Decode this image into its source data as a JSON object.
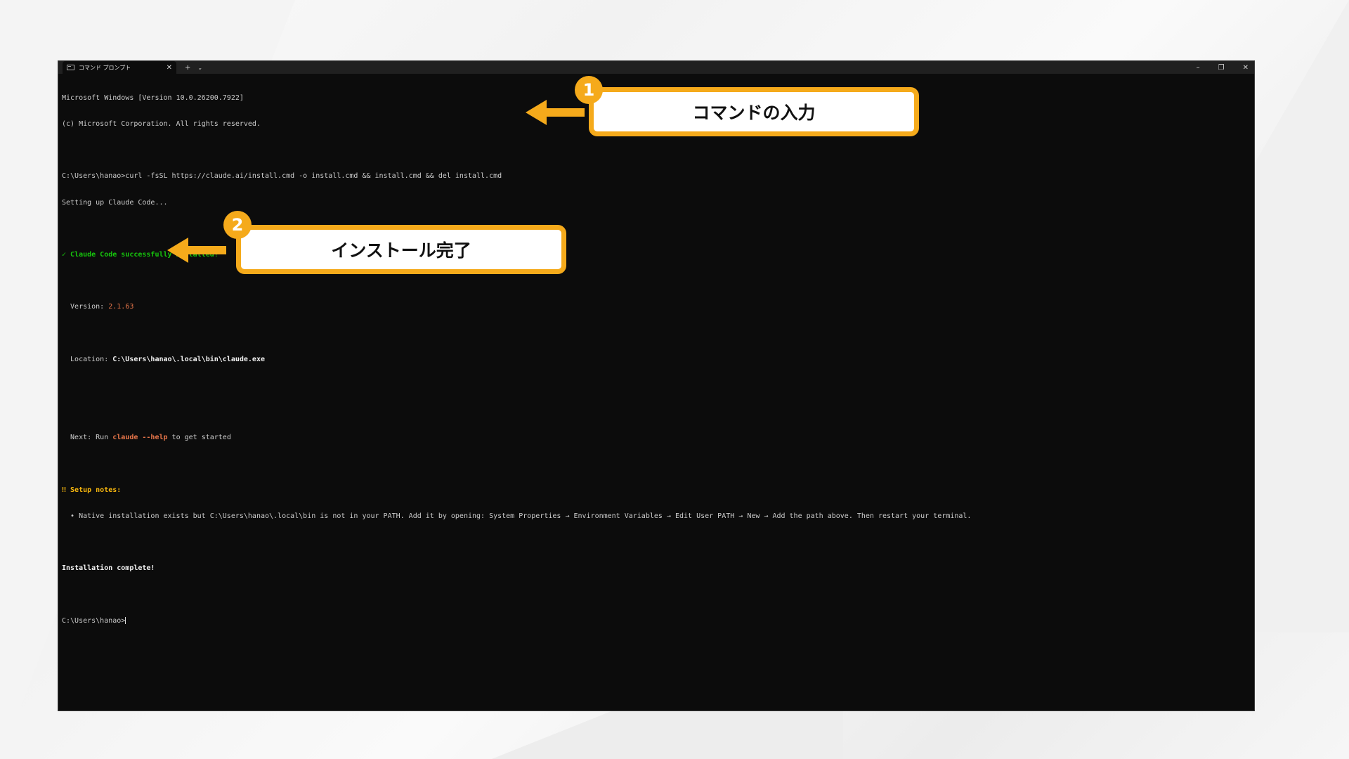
{
  "window": {
    "tab_title": "コマンド プロンプト",
    "tab_close": "✕",
    "new_tab": "+",
    "dropdown": "⌄",
    "minimize": "–",
    "restore": "❐",
    "close": "✕"
  },
  "terminal": {
    "lines": {
      "l1": "Microsoft Windows [Version 10.0.26200.7922]",
      "l2": "(c) Microsoft Corporation. All rights reserved.",
      "l3": "C:\\Users\\hanao>curl -fsSL https://claude.ai/install.cmd -o install.cmd && install.cmd && del install.cmd",
      "l4": "Setting up Claude Code...",
      "l5": "✓ Claude Code successfully installed!",
      "version_label": "  Version: ",
      "version_value": "2.1.63",
      "location_label": "  Location: ",
      "location_value": "C:\\Users\\hanao\\.local\\bin\\claude.exe",
      "next_prefix": "  Next: Run ",
      "next_cmd": "claude --help",
      "next_suffix": " to get started",
      "setup_notes": "‼ Setup notes:",
      "setup_detail": "  • Native installation exists but C:\\Users\\hanao\\.local\\bin is not in your PATH. Add it by opening: System Properties → Environment Variables → Edit User PATH → New → Add the path above. Then restart your terminal.",
      "complete": "Installation complete!",
      "prompt": "C:\\Users\\hanao>"
    }
  },
  "callouts": {
    "c1": {
      "number": "1",
      "label": "コマンドの入力"
    },
    "c2": {
      "number": "2",
      "label": "インストール完了"
    }
  },
  "colors": {
    "accent": "#f5aa1b",
    "terminal_bg": "#0c0c0c",
    "success": "#16c60c",
    "highlight": "#e8764a"
  }
}
